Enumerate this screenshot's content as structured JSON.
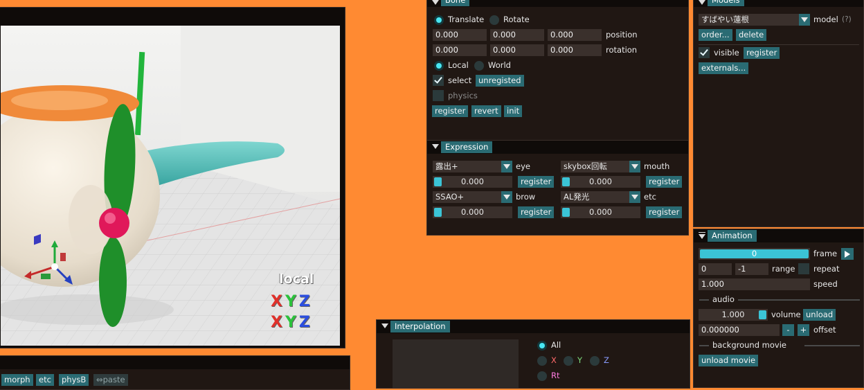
{
  "viewport": {
    "gizmo_label": "local",
    "axes_row1": [
      "X",
      "Y",
      "Z"
    ],
    "axes_row2": [
      "X",
      "Y",
      "Z"
    ]
  },
  "bottom_toolbar": {
    "buttons": [
      "morph",
      "etc",
      "physB"
    ],
    "paste_label": "⇔paste"
  },
  "bone": {
    "tab": "Bone",
    "translate_label": "Translate",
    "rotate_label": "Rotate",
    "position": [
      "0.000",
      "0.000",
      "0.000"
    ],
    "position_label": "position",
    "rotation": [
      "0.000",
      "0.000",
      "0.000"
    ],
    "rotation_label": "rotation",
    "local_label": "Local",
    "world_label": "World",
    "select_label": "select",
    "unregisted_label": "unregisted",
    "physics_label": "physics",
    "register_label": "register",
    "revert_label": "revert",
    "init_label": "init"
  },
  "expression": {
    "tab": "Expression",
    "eye_select": "露出+",
    "eye_label": "eye",
    "mouth_select": "skybox回転",
    "mouth_label": "mouth",
    "eye_value": "0.000",
    "mouth_value": "0.000",
    "brow_select": "SSAO+",
    "brow_label": "brow",
    "etc_select": "AL発光",
    "etc_label": "etc",
    "brow_value": "0.000",
    "etc_value": "0.000",
    "register_label": "register"
  },
  "models": {
    "tab": "Models",
    "model_select": "すばやい蓮根",
    "model_label": "model",
    "help": "(?)",
    "order_label": "order...",
    "delete_label": "delete",
    "visible_label": "visible",
    "register_label": "register",
    "externals_label": "externals..."
  },
  "animation": {
    "tab": "Animation",
    "frame_value": "0",
    "frame_label": "frame",
    "range_start": "0",
    "range_end": "-1",
    "range_label": "range",
    "repeat_label": "repeat",
    "speed_value": "1.000",
    "speed_label": "speed",
    "audio_header": "audio",
    "volume_value": "1.000",
    "volume_label": "volume",
    "unload_label": "unload",
    "offset_value": "0.000000",
    "minus_label": "-",
    "plus_label": "+",
    "offset_label": "offset",
    "bgmovie_header": "background movie",
    "unload_movie_label": "unload movie"
  },
  "interpolation": {
    "tab": "Interpolation",
    "all_label": "All",
    "x_label": "X",
    "y_label": "Y",
    "z_label": "Z",
    "rt_label": "Rt"
  }
}
